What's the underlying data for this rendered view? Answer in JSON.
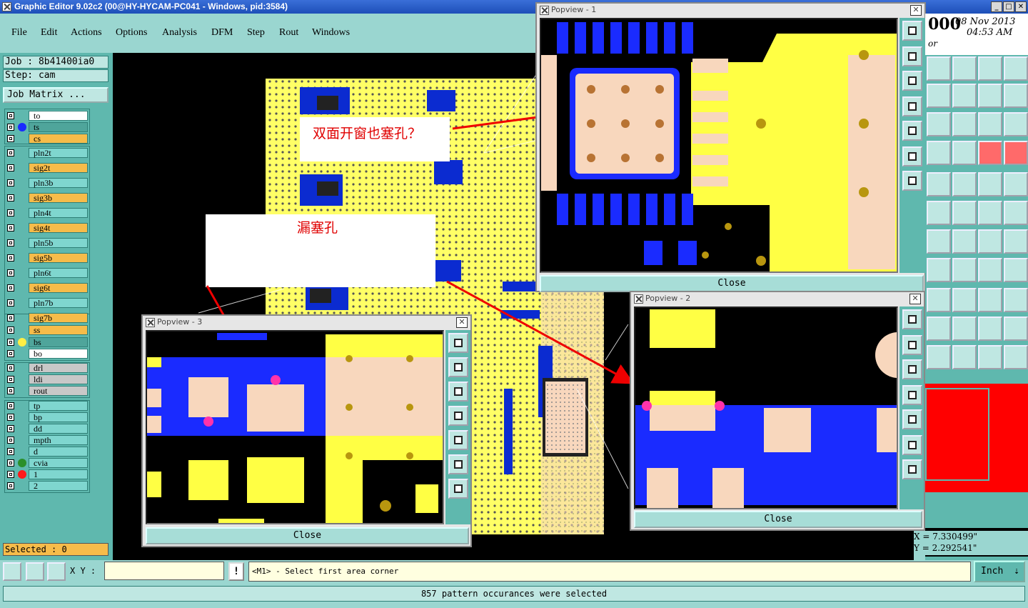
{
  "window": {
    "title": "Graphic Editor 9.02c2 (00@HY-HYCAM-PC041 - Windows, pid:3584)"
  },
  "menu": [
    "File",
    "Edit",
    "Actions",
    "Options",
    "Analysis",
    "DFM",
    "Step",
    "Rout",
    "Windows"
  ],
  "job": {
    "job_text": "Job : 8b41400ia0",
    "step_text": "Step: cam",
    "matrix_button": "Job Matrix ..."
  },
  "layers": [
    {
      "name": "to",
      "color": "#ffffff",
      "dot": ""
    },
    {
      "name": "ts",
      "color": "#4fa59b",
      "dot": "#1a2bff"
    },
    {
      "name": "cs",
      "color": "#f6bc4a",
      "dot": ""
    },
    {
      "name": "pln2t",
      "color": "#7fd6cf",
      "dot": ""
    },
    {
      "name": "sig2t",
      "color": "#f6bc4a",
      "dot": ""
    },
    {
      "name": "pln3b",
      "color": "#7fd6cf",
      "dot": ""
    },
    {
      "name": "sig3b",
      "color": "#f6bc4a",
      "dot": ""
    },
    {
      "name": "pln4t",
      "color": "#7fd6cf",
      "dot": ""
    },
    {
      "name": "sig4t",
      "color": "#f6bc4a",
      "dot": ""
    },
    {
      "name": "pln5b",
      "color": "#7fd6cf",
      "dot": ""
    },
    {
      "name": "sig5b",
      "color": "#f6bc4a",
      "dot": ""
    },
    {
      "name": "pln6t",
      "color": "#7fd6cf",
      "dot": ""
    },
    {
      "name": "sig6t",
      "color": "#f6bc4a",
      "dot": ""
    },
    {
      "name": "pln7b",
      "color": "#7fd6cf",
      "dot": ""
    },
    {
      "name": "sig7b",
      "color": "#f6bc4a",
      "dot": ""
    },
    {
      "name": "ss",
      "color": "#f6bc4a",
      "dot": ""
    },
    {
      "name": "bs",
      "color": "#4fa59b",
      "dot": "#ffee44"
    },
    {
      "name": "bo",
      "color": "#ffffff",
      "dot": ""
    },
    {
      "name": "drl",
      "color": "#c8c8c8",
      "dot": ""
    },
    {
      "name": "ldi",
      "color": "#c8c8c8",
      "dot": ""
    },
    {
      "name": "rout",
      "color": "#c8c8c8",
      "dot": ""
    },
    {
      "name": "tp",
      "color": "#7fd6cf",
      "dot": ""
    },
    {
      "name": "bp",
      "color": "#7fd6cf",
      "dot": ""
    },
    {
      "name": "dd",
      "color": "#7fd6cf",
      "dot": ""
    },
    {
      "name": "mpth",
      "color": "#7fd6cf",
      "dot": ""
    },
    {
      "name": "d",
      "color": "#7fd6cf",
      "dot": ""
    },
    {
      "name": "cvia",
      "color": "#7fd6cf",
      "dot": "#2a8f2a"
    },
    {
      "name": "1",
      "color": "#7fd6cf",
      "dot": "#ff1a1a"
    },
    {
      "name": "2",
      "color": "#7fd6cf",
      "dot": ""
    }
  ],
  "selected_text": "Selected : 0",
  "annotations": {
    "top": "双面开窗也塞孔？",
    "mid": "漏塞孔"
  },
  "popviews": [
    {
      "title": "Popview - 1",
      "close": "Close"
    },
    {
      "title": "Popview - 2",
      "close": "Close"
    },
    {
      "title": "Popview - 3",
      "close": "Close"
    }
  ],
  "datetime": {
    "digits": "000",
    "date": "08 Nov 2013",
    "time": "04:53 AM",
    "sub": "or"
  },
  "coords": {
    "x": "X = 7.330499\"",
    "y": "Y = 2.292541\""
  },
  "bottom": {
    "xy_label": "X Y :",
    "xy_value": "",
    "alert": "!",
    "message": "<M1> - Select first area corner",
    "units": "Inch"
  },
  "status_text": "857 pattern occurances were selected",
  "colors": {
    "teal": "#5fb8ae",
    "pcb_yellow": "#ffff44",
    "pad_peach": "#f8d7bd",
    "blue": "#1a2bff"
  }
}
